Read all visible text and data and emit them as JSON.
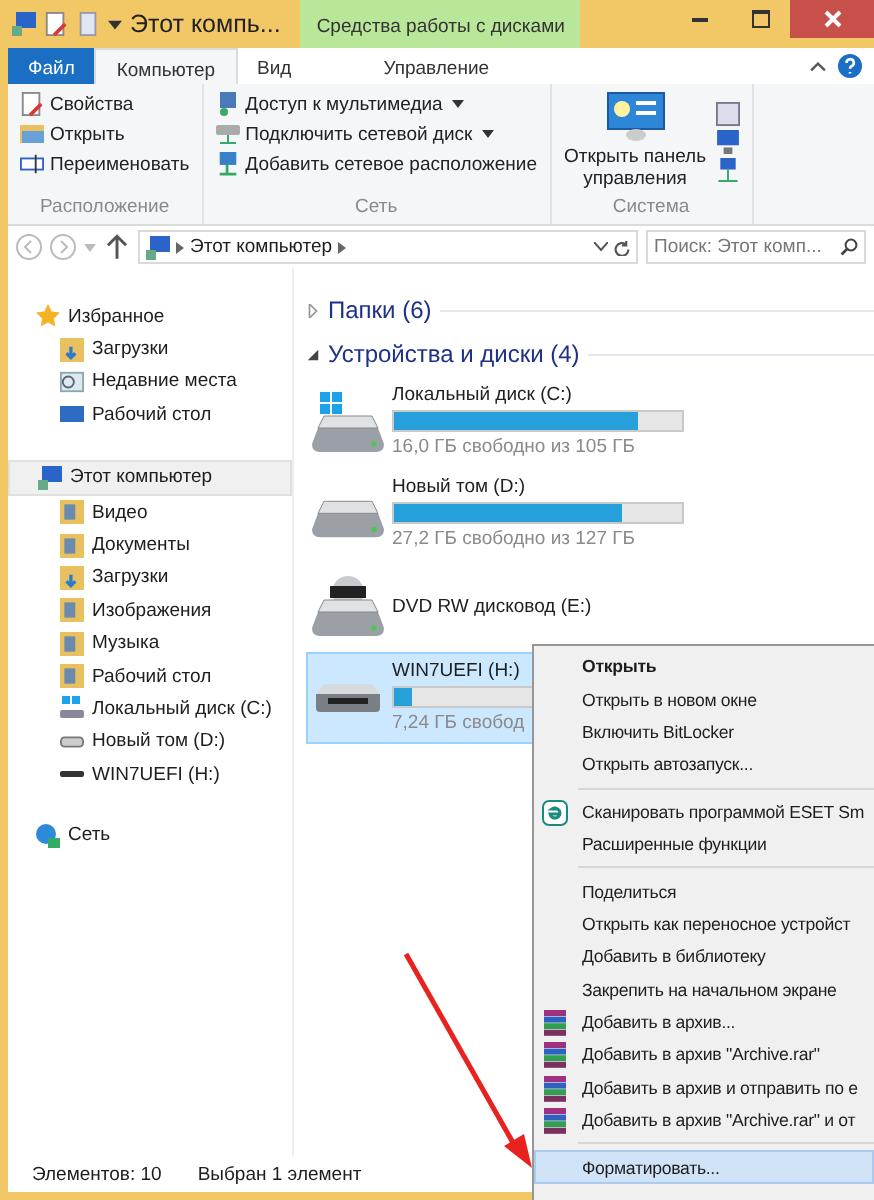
{
  "window": {
    "title": "Этот компь...",
    "context_title": "Средства работы с дисками"
  },
  "ribbon_tabs": [
    {
      "label": "Файл",
      "kind": "file",
      "selected": false
    },
    {
      "label": "Компьютер",
      "kind": "tab",
      "selected": true
    },
    {
      "label": "Вид",
      "kind": "tab",
      "selected": false
    },
    {
      "label": "Управление",
      "kind": "context",
      "selected": false
    }
  ],
  "ribbon_groups": [
    {
      "name": "Расположение",
      "kind": "list",
      "items": [
        {
          "label": "Свойства",
          "dropdown": false
        },
        {
          "label": "Открыть",
          "dropdown": false
        },
        {
          "label": "Переименовать",
          "dropdown": false
        }
      ]
    },
    {
      "name": "Сеть",
      "kind": "list",
      "items": [
        {
          "label": "Доступ к мультимедиа",
          "dropdown": true
        },
        {
          "label": "Подключить сетевой диск",
          "dropdown": true
        },
        {
          "label": "Добавить сетевое расположение",
          "dropdown": false
        }
      ]
    },
    {
      "name": "Система",
      "kind": "large",
      "items": [
        {
          "label": "Открыть панель управления"
        }
      ]
    }
  ],
  "address_bar": {
    "path": [
      "Этот компьютер"
    ],
    "search_placeholder": "Поиск: Этот комп..."
  },
  "sidebar": [
    {
      "label": "Избранное",
      "selected": false,
      "children": [
        {
          "label": "Загрузки",
          "selected": false
        },
        {
          "label": "Недавние места",
          "selected": false
        },
        {
          "label": "Рабочий стол",
          "selected": false
        }
      ]
    },
    {
      "label": "Этот компьютер",
      "selected": true,
      "children": [
        {
          "label": "Видео",
          "selected": false
        },
        {
          "label": "Документы",
          "selected": false
        },
        {
          "label": "Загрузки",
          "selected": false
        },
        {
          "label": "Изображения",
          "selected": false
        },
        {
          "label": "Музыка",
          "selected": false
        },
        {
          "label": "Рабочий стол",
          "selected": false
        },
        {
          "label": "Локальный диск (C:)",
          "selected": false
        },
        {
          "label": "Новый том (D:)",
          "selected": false
        },
        {
          "label": "WIN7UEFI (H:)",
          "selected": false
        }
      ]
    },
    {
      "label": "Сеть",
      "selected": false
    }
  ],
  "groups": [
    {
      "title": "Папки (6)",
      "expanded": false
    },
    {
      "title": "Устройства и диски (4)",
      "expanded": true,
      "drives": [
        {
          "name": "Локальный диск (C:)",
          "kind": "windows",
          "selected": false,
          "level": 0.85,
          "free": "16,0 ГБ свободно из 105 ГБ"
        },
        {
          "name": "Новый том (D:)",
          "kind": "hdd",
          "selected": false,
          "level": 0.79,
          "free": "27,2 ГБ свободно из 127 ГБ"
        },
        {
          "name": "DVD RW дисковод (E:)",
          "kind": "dvd",
          "selected": false
        },
        {
          "name": "WIN7UEFI (H:)",
          "kind": "usb",
          "selected": true,
          "level": 0.06,
          "free": "7,24 ГБ свобод"
        }
      ]
    }
  ],
  "status_bar": {
    "count": "Элементов: 10",
    "selection": "Выбран 1 элемент"
  },
  "context_menu": [
    [
      {
        "label": "Открыть",
        "kind": "plain",
        "bold": true,
        "selected": false
      },
      {
        "label": "Открыть в новом окне",
        "kind": "plain",
        "bold": false,
        "selected": false
      },
      {
        "label": "Включить BitLocker",
        "kind": "plain",
        "bold": false,
        "selected": false
      },
      {
        "label": "Открыть автозапуск...",
        "kind": "plain",
        "bold": false,
        "selected": false
      }
    ],
    [
      {
        "label": "Сканировать программой ESET Sm",
        "kind": "eset",
        "bold": false,
        "selected": false
      },
      {
        "label": "Расширенные функции",
        "kind": "plain",
        "bold": false,
        "selected": false
      }
    ],
    [
      {
        "label": "Поделиться",
        "kind": "plain",
        "bold": false,
        "selected": false
      },
      {
        "label": "Открыть как переносное устройст",
        "kind": "plain",
        "bold": false,
        "selected": false
      },
      {
        "label": "Добавить в библиотеку",
        "kind": "plain",
        "bold": false,
        "selected": false
      },
      {
        "label": "Закрепить на начальном экране",
        "kind": "plain",
        "bold": false,
        "selected": false
      },
      {
        "label": "Добавить в архив...",
        "kind": "rar",
        "bold": false,
        "selected": false
      },
      {
        "label": "Добавить в архив \"Archive.rar\"",
        "kind": "rar",
        "bold": false,
        "selected": false
      },
      {
        "label": "Добавить в архив и отправить по e",
        "kind": "rar",
        "bold": false,
        "selected": false
      },
      {
        "label": "Добавить в архив \"Archive.rar\" и от",
        "kind": "rar",
        "bold": false,
        "selected": false
      }
    ],
    [
      {
        "label": "Форматировать...",
        "kind": "plain",
        "bold": false,
        "selected": true
      }
    ]
  ]
}
